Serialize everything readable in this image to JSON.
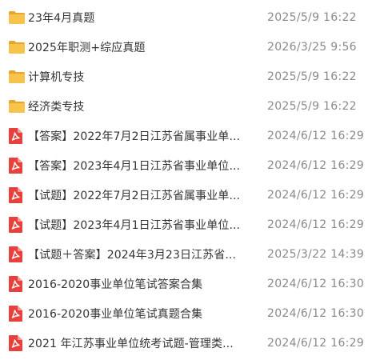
{
  "colors": {
    "folder": "#f7c34a",
    "pdf": "#e8403c",
    "name_text": "#333333",
    "date_text": "#8a8a8a"
  },
  "files": [
    {
      "type": "folder",
      "icon": "folder-icon",
      "name": "23年4月真题",
      "date": "2025/5/9 16:22"
    },
    {
      "type": "folder",
      "icon": "folder-icon",
      "name": "2025年职测+综应真题",
      "date": "2026/3/25 9:56"
    },
    {
      "type": "folder",
      "icon": "folder-icon",
      "name": "计算机专技",
      "date": "2025/5/9 16:22"
    },
    {
      "type": "folder",
      "icon": "folder-icon",
      "name": "经济类专技",
      "date": "2025/5/9 16:22"
    },
    {
      "type": "pdf",
      "icon": "pdf-icon",
      "name": "【答案】2022年7月2日江苏省属事业单...",
      "date": "2024/6/12 16:29"
    },
    {
      "type": "pdf",
      "icon": "pdf-icon",
      "name": "【答案】2023年4月1日江苏省事业单位...",
      "date": "2024/6/12 16:29"
    },
    {
      "type": "pdf",
      "icon": "pdf-icon",
      "name": "【试题】2022年7月2日江苏省属事业单...",
      "date": "2024/6/12 16:29"
    },
    {
      "type": "pdf",
      "icon": "pdf-icon",
      "name": "【试题】2023年4月1日江苏省事业单位...",
      "date": "2024/6/12 16:29"
    },
    {
      "type": "pdf",
      "icon": "pdf-icon",
      "name": "【试题＋答案】2024年3月23日江苏省...",
      "date": "2025/3/22 14:39"
    },
    {
      "type": "pdf",
      "icon": "pdf-icon",
      "name": "2016-2020事业单位笔试答案合集",
      "date": "2024/6/12 16:30"
    },
    {
      "type": "pdf",
      "icon": "pdf-icon",
      "name": "2016-2020事业单位笔试真题合集",
      "date": "2024/6/12 16:30"
    },
    {
      "type": "pdf",
      "icon": "pdf-icon",
      "name": "2021 年江苏事业单位统考试题-管理类...",
      "date": "2024/6/12 16:29"
    }
  ]
}
